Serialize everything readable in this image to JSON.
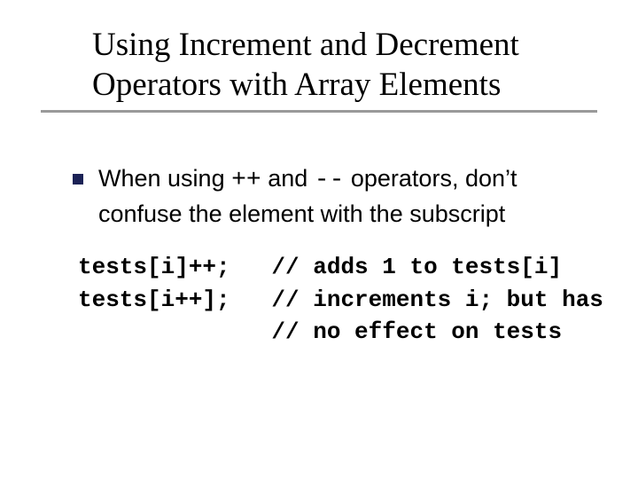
{
  "title_line1": "Using Increment and Decrement",
  "title_line2": "Operators with Array Elements",
  "bullet_pre": "When using ",
  "bullet_op1": "++",
  "bullet_mid": " and ",
  "bullet_op2": "--",
  "bullet_post": " operators, don’t confuse the element with the subscript",
  "code_line1": "tests[i]++;   // adds 1 to tests[i]",
  "code_line2": "tests[i++];   // increments i; but has",
  "code_line3": "              // no effect on tests"
}
